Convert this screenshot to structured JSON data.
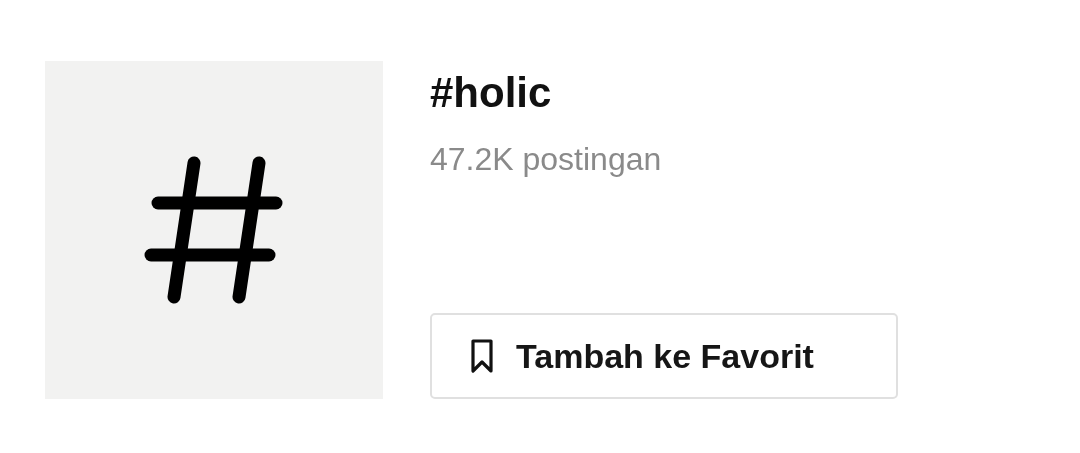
{
  "hashtag": {
    "title": "#holic",
    "post_count": "47.2K postingan"
  },
  "favorite_button": {
    "label": "Tambah ke Favorit"
  }
}
